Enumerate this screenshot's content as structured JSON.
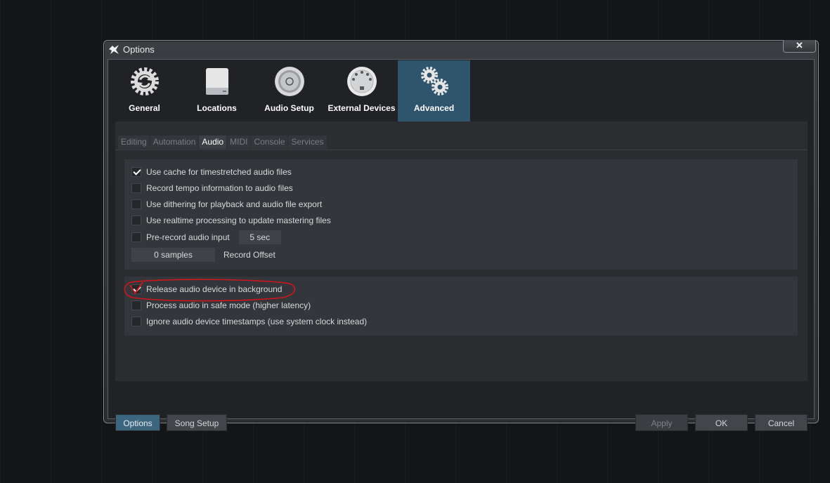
{
  "window": {
    "title": "Options",
    "close_label": "✕"
  },
  "categories": [
    {
      "label": "General",
      "icon": "gear-sync-icon"
    },
    {
      "label": "Locations",
      "icon": "drive-icon"
    },
    {
      "label": "Audio Setup",
      "icon": "speaker-icon"
    },
    {
      "label": "External Devices",
      "icon": "midi-port-icon"
    },
    {
      "label": "Advanced",
      "icon": "gears-icon",
      "active": true
    }
  ],
  "subtabs": [
    "Editing",
    "Automation",
    "Audio",
    "MIDI",
    "Console",
    "Services"
  ],
  "active_subtab": "Audio",
  "group1": {
    "options": [
      {
        "label": "Use cache for timestretched audio files",
        "checked": true
      },
      {
        "label": "Record tempo information to audio files",
        "checked": false
      },
      {
        "label": "Use dithering for playback and audio file export",
        "checked": false
      },
      {
        "label": "Use realtime processing to update mastering files",
        "checked": false
      },
      {
        "label": "Pre-record audio input",
        "checked": false
      }
    ],
    "prerecord_value": "5 sec",
    "record_offset_value": "0 samples",
    "record_offset_label": "Record Offset"
  },
  "group2": {
    "options": [
      {
        "label": "Release audio device in background",
        "checked": true
      },
      {
        "label": "Process audio in safe mode (higher latency)",
        "checked": false
      },
      {
        "label": "Ignore audio device timestamps (use system clock instead)",
        "checked": false
      }
    ]
  },
  "footer": {
    "options_label": "Options",
    "song_setup_label": "Song Setup",
    "apply_label": "Apply",
    "ok_label": "OK",
    "cancel_label": "Cancel"
  },
  "colors": {
    "accent": "#2f556d",
    "annotation": "#d0161b"
  }
}
